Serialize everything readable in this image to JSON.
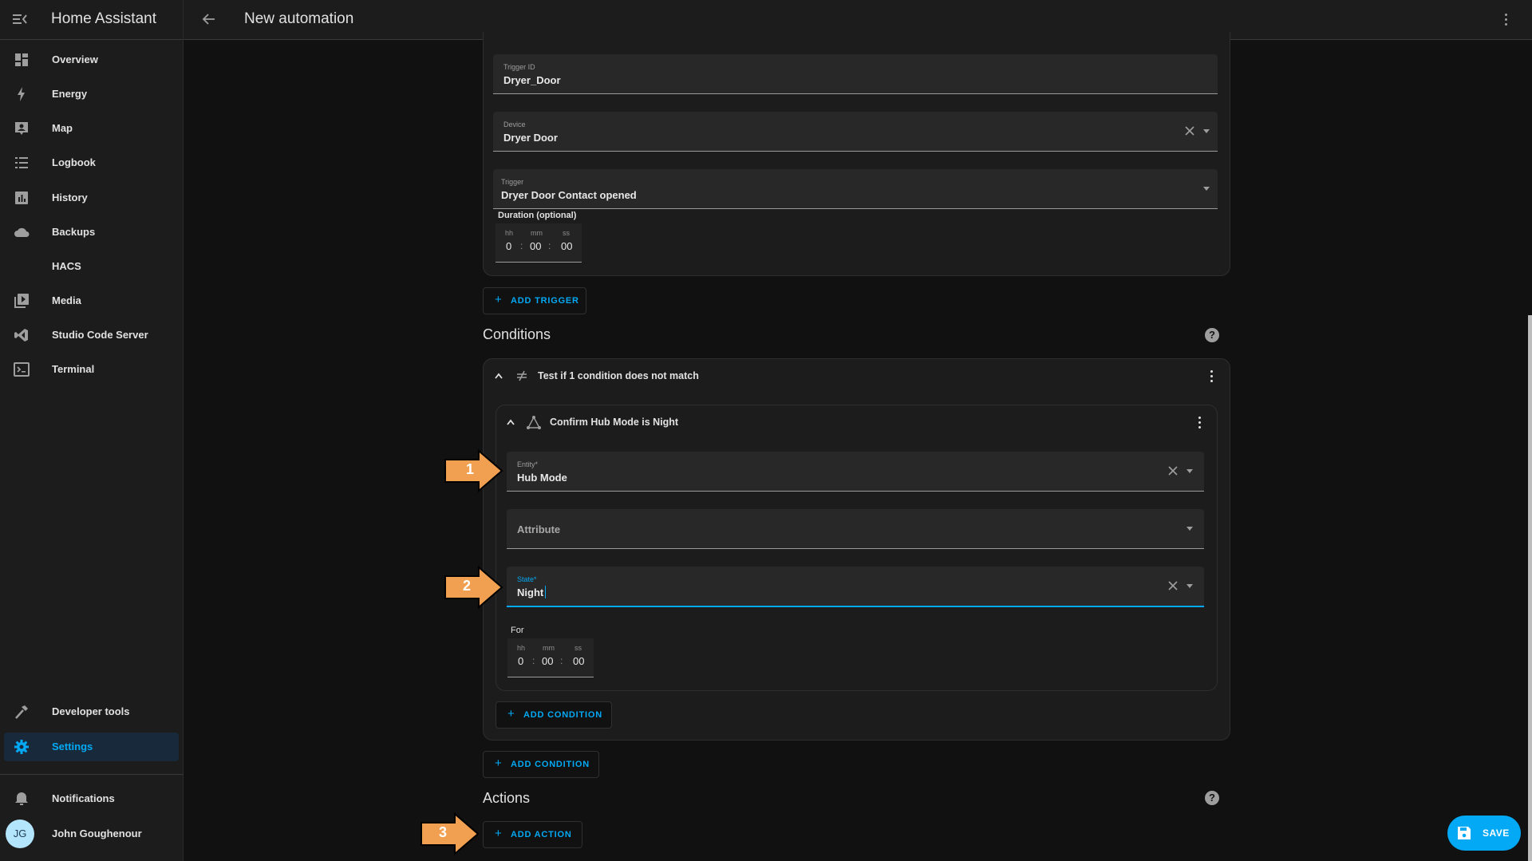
{
  "app": {
    "title": "Home Assistant"
  },
  "header": {
    "title": "New automation",
    "back_icon": "arrow-left-icon",
    "menu_icon": "dots-vertical-icon"
  },
  "sidebar": {
    "items": [
      {
        "label": "Overview",
        "icon": "view-dashboard-icon"
      },
      {
        "label": "Energy",
        "icon": "lightning-bolt-icon"
      },
      {
        "label": "Map",
        "icon": "map-account-icon"
      },
      {
        "label": "Logbook",
        "icon": "format-list-icon"
      },
      {
        "label": "History",
        "icon": "chart-box-icon"
      },
      {
        "label": "Backups",
        "icon": "cloud-icon"
      },
      {
        "label": "HACS",
        "icon": ""
      },
      {
        "label": "Media",
        "icon": "play-box-multiple-icon"
      },
      {
        "label": "Studio Code Server",
        "icon": "vscode-icon"
      },
      {
        "label": "Terminal",
        "icon": "console-icon"
      }
    ],
    "developer_tools": "Developer tools",
    "settings": "Settings",
    "notifications": "Notifications",
    "user": {
      "name": "John Goughenour",
      "initials": "JG"
    }
  },
  "trigger": {
    "trigger_id": {
      "label": "Trigger ID",
      "value": "Dryer_Door"
    },
    "device": {
      "label": "Device",
      "value": "Dryer Door"
    },
    "trigger": {
      "label": "Trigger",
      "value": "Dryer Door Contact opened"
    },
    "duration": {
      "label": "Duration (optional)",
      "hh_label": "hh",
      "mm_label": "mm",
      "ss_label": "ss",
      "hh": "0",
      "mm": "00",
      "ss": "00"
    },
    "add_trigger": "ADD TRIGGER"
  },
  "conditions": {
    "title": "Conditions",
    "outer": {
      "title": "Test if 1 condition does not match"
    },
    "inner": {
      "title": "Confirm Hub Mode is Night",
      "entity": {
        "label": "Entity*",
        "value": "Hub Mode"
      },
      "attribute": {
        "placeholder": "Attribute"
      },
      "state": {
        "label": "State*",
        "value": "Night"
      },
      "for": {
        "label": "For",
        "hh_label": "hh",
        "mm_label": "mm",
        "ss_label": "ss",
        "hh": "0",
        "mm": "00",
        "ss": "00"
      }
    },
    "inner_add_condition": "ADD CONDITION",
    "add_condition": "ADD CONDITION"
  },
  "actions": {
    "title": "Actions",
    "add_action": "ADD ACTION"
  },
  "save": {
    "label": "SAVE"
  },
  "annotations": {
    "arrow1": "1",
    "arrow2": "2",
    "arrow3": "3"
  },
  "colors": {
    "accent": "#03a9f4",
    "annotation_arrow": "#f0a050",
    "background": "#111111",
    "card": "#1c1c1c"
  }
}
